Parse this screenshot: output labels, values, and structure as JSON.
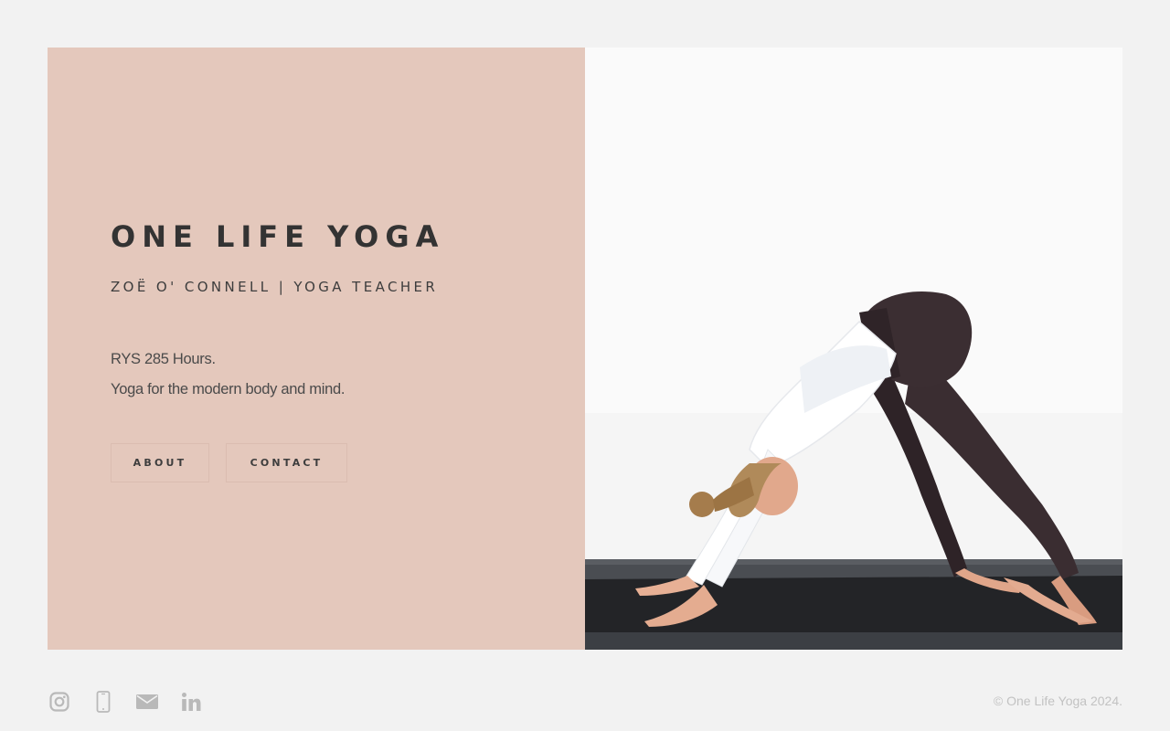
{
  "hero": {
    "title": "ONE LIFE YOGA",
    "subtitle": "ZOË O' CONNELL | YOGA TEACHER",
    "desc_line1": "RYS 285 Hours.",
    "desc_line2": "Yoga for the modern body and mind.",
    "about_label": "ABOUT",
    "contact_label": "CONTACT",
    "panel_color": "#e4c8bc",
    "image_alt": "Woman doing downward-facing dog on a black yoga mat against a white wall"
  },
  "footer": {
    "icons": [
      "instagram-icon",
      "phone-icon",
      "mail-icon",
      "linkedin-icon"
    ],
    "copyright": "© One Life Yoga 2024."
  }
}
